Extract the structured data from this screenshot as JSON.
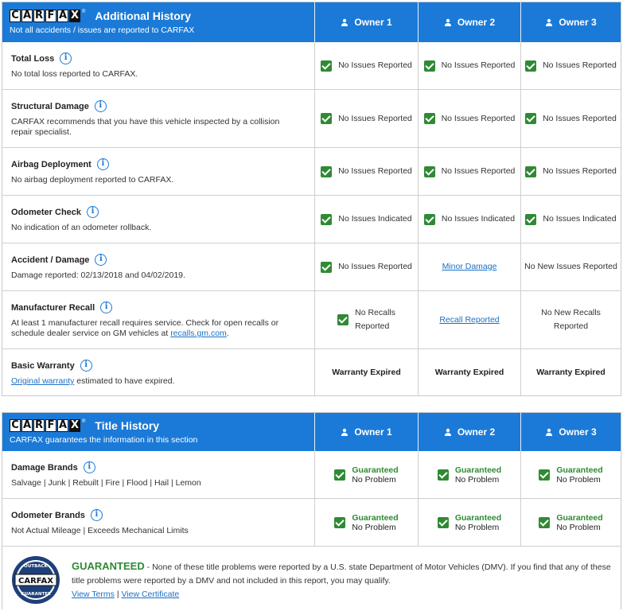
{
  "additional_history": {
    "title": "Additional History",
    "subtitle": "Not all accidents / issues are reported to CARFAX",
    "owners": [
      "Owner 1",
      "Owner 2",
      "Owner 3"
    ],
    "rows": [
      {
        "label": "Total Loss",
        "desc": "No total loss reported to CARFAX.",
        "cells": [
          "No Issues Reported",
          "No Issues Reported",
          "No Issues Reported"
        ]
      },
      {
        "label": "Structural Damage",
        "desc": "CARFAX recommends that you have this vehicle inspected by a collision repair specialist.",
        "cells": [
          "No Issues Reported",
          "No Issues Reported",
          "No Issues Reported"
        ]
      },
      {
        "label": "Airbag Deployment",
        "desc": "No airbag deployment reported to CARFAX.",
        "cells": [
          "No Issues Reported",
          "No Issues Reported",
          "No Issues Reported"
        ]
      },
      {
        "label": "Odometer Check",
        "desc": "No indication of an odometer rollback.",
        "cells": [
          "No Issues Indicated",
          "No Issues Indicated",
          "No Issues Indicated"
        ]
      },
      {
        "label": "Accident / Damage",
        "desc": "Damage reported: 02/13/2018 and 04/02/2019.",
        "cells": [
          "No Issues Reported",
          "Minor Damage",
          "No New Issues Reported"
        ]
      },
      {
        "label": "Manufacturer Recall",
        "desc_line1": "At least 1 manufacturer recall requires service. Check for open recalls or",
        "desc_line2_prefix": "schedule dealer service on GM vehicles at",
        "desc_link": "recalls.gm.com",
        "desc_suffix": ".",
        "cell1_line1": "No Recalls",
        "cell1_line2": "Reported",
        "cell2": "Recall Reported",
        "cell3_line1": "No New Recalls",
        "cell3_line2": "Reported"
      },
      {
        "label": "Basic Warranty",
        "desc_link": "Original warranty",
        "desc_rest": "estimated to have expired.",
        "cells": [
          "Warranty Expired",
          "Warranty Expired",
          "Warranty Expired"
        ]
      }
    ]
  },
  "title_history": {
    "title": "Title History",
    "subtitle": "CARFAX guarantees the information in this section",
    "owners": [
      "Owner 1",
      "Owner 2",
      "Owner 3"
    ],
    "status_line1": "Guaranteed",
    "status_line2": "No Problem",
    "rows": [
      {
        "label": "Damage Brands",
        "desc": "Salvage | Junk | Rebuilt | Fire | Flood | Hail | Lemon"
      },
      {
        "label": "Odometer Brands",
        "desc": "Not Actual Mileage | Exceeds Mechanical Limits"
      }
    ]
  },
  "guarantee": {
    "word": "GUARANTEED",
    "text": " - None of these title problems were reported by a U.S. state Department of Motor Vehicles (DMV). If you find that any of these title problems were reported by a DMV and not included in this report, you may qualify.",
    "link_terms": "View Terms",
    "separator": "|",
    "link_certificate": "View Certificate",
    "seal_top": "OUTBACK",
    "seal_brand": "CARFAX",
    "seal_bottom": "GUARANTEE"
  },
  "logo_letters": [
    "C",
    "A",
    "R",
    "F",
    "A",
    "X"
  ],
  "colors": {
    "header_blue": "#1b7ad7",
    "check_green": "#2f8a34",
    "link_blue": "#1b6fc4"
  }
}
